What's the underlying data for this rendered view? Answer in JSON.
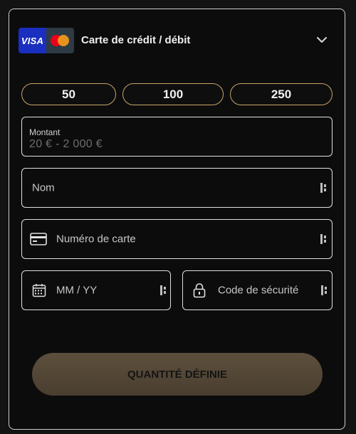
{
  "payment": {
    "method_title": "Carte de crédit / débit",
    "visa_label": "VISA"
  },
  "amounts": [
    "50",
    "100",
    "250"
  ],
  "amount_field": {
    "label": "Montant",
    "range": "20 € - 2 000 €"
  },
  "fields": {
    "name_placeholder": "Nom",
    "card_number_placeholder": "Numéro de carte",
    "expiry_placeholder": "MM / YY",
    "cvv_placeholder": "Code de sécurité"
  },
  "submit_label": "QUANTITÉ DÉFINIE",
  "colors": {
    "accent_gold": "#c8a468",
    "button_brown": "#53473a",
    "visa_blue": "#1a2fbf"
  }
}
